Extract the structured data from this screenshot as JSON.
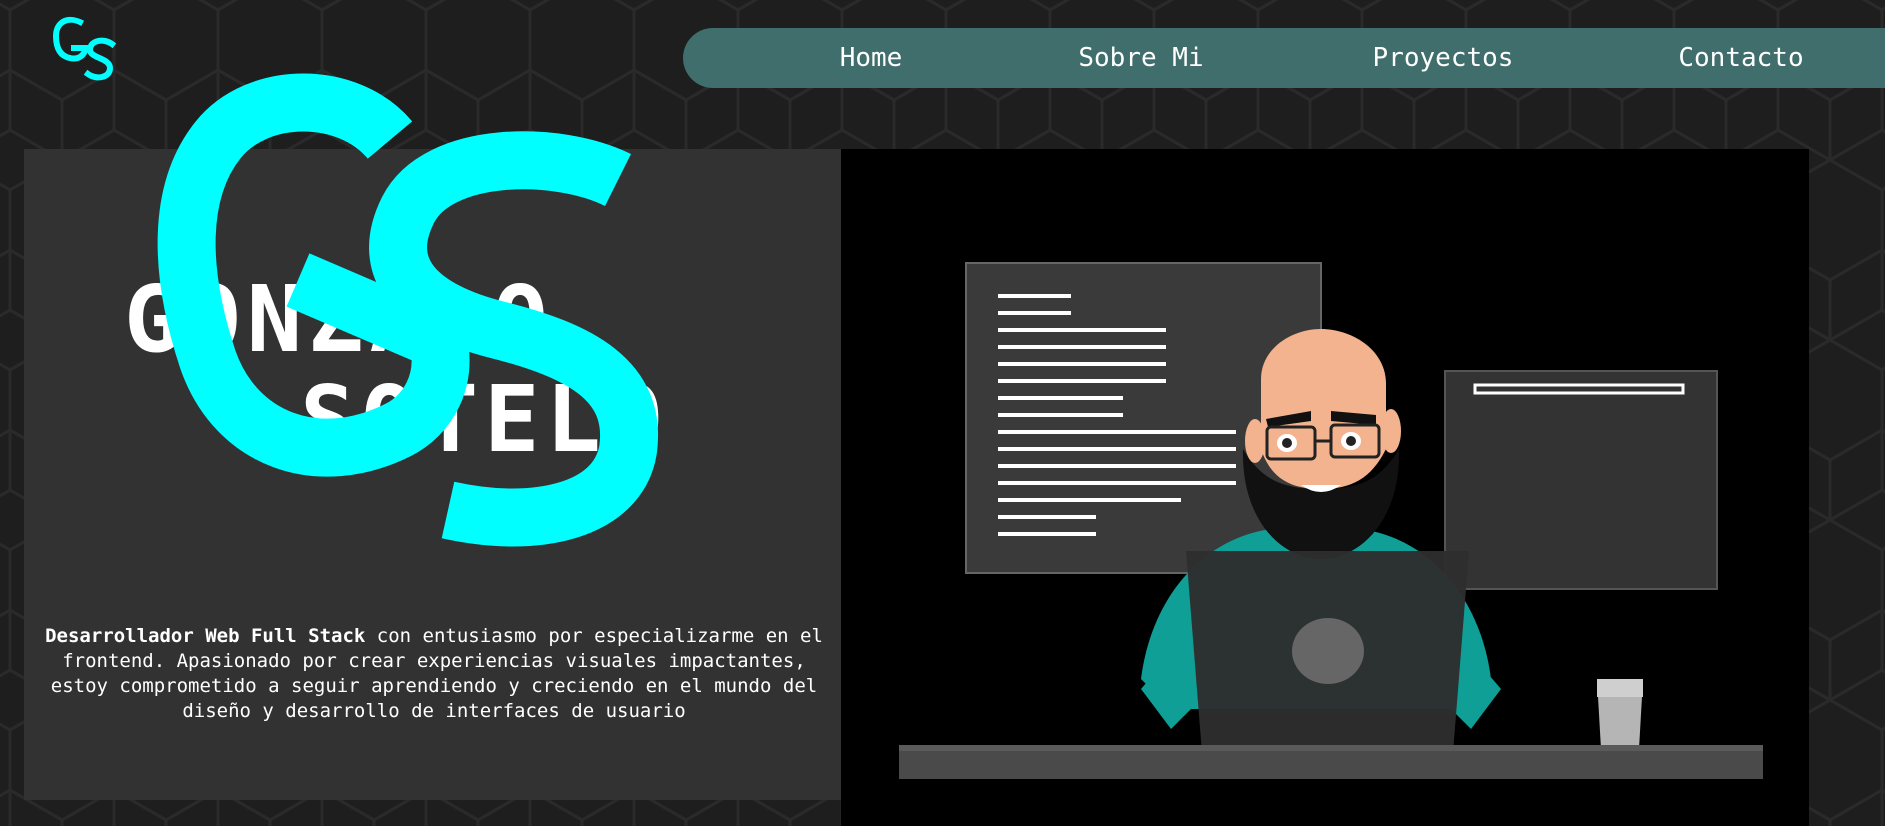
{
  "logo": {
    "text": "GS",
    "accent": "#00ffff"
  },
  "nav": {
    "items": [
      {
        "label": "Home"
      },
      {
        "label": "Sobre Mi"
      },
      {
        "label": "Proyectos"
      },
      {
        "label": "Contacto"
      }
    ],
    "background": "#3f6e6c"
  },
  "hero": {
    "name_line1": "GONZALO",
    "name_line2": "SOTELO",
    "description_bold": "Desarrollador Web Full Stack",
    "description_rest": " con entusiasmo por especializarme en el frontend. Apasionado por crear experiencias visuales impactantes, estoy comprometido a seguir aprendiendo y creciendo en el mundo del diseño y desarrollo de interfaces de usuario"
  },
  "colors": {
    "page_background": "#1e1e1e",
    "panel_left": "#323232",
    "panel_right": "#000000",
    "accent": "#00ffff",
    "shirt": "#0f9f96"
  },
  "illustration": {
    "subject": "developer-at-laptop",
    "icons": [
      "code-window-icon",
      "browser-window-icon",
      "laptop-icon",
      "glass-icon"
    ]
  }
}
